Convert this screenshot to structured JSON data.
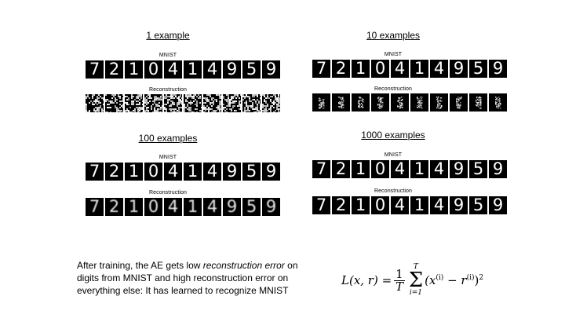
{
  "digits": [
    "7",
    "2",
    "1",
    "0",
    "4",
    "1",
    "4",
    "9",
    "5",
    "9"
  ],
  "row_labels": {
    "mnist": "MNIST",
    "reconstruction": "Reconstruction"
  },
  "panels": [
    {
      "title": "1 example",
      "reconstruction_style": "noise"
    },
    {
      "title": "10 examples",
      "reconstruction_style": "blurry-blob"
    },
    {
      "title": "100 examples",
      "reconstruction_style": "approximate-digits"
    },
    {
      "title": "1000 examples",
      "reconstruction_style": "clear-digits"
    }
  ],
  "caption": {
    "before": "After training, the AE gets low ",
    "emphasis": "reconstruction error",
    "after": " on digits from MNIST and high reconstruction error on everything else: It has learned to recognize MNIST"
  },
  "formula": {
    "lhs": "L(x, r) =",
    "frac_num": "1",
    "frac_den": "T",
    "sum_top": "T",
    "sum_bottom": "i=1",
    "body": "(x",
    "sup_i": "(i)",
    "minus": " − r",
    "close": ")",
    "power": "2"
  }
}
